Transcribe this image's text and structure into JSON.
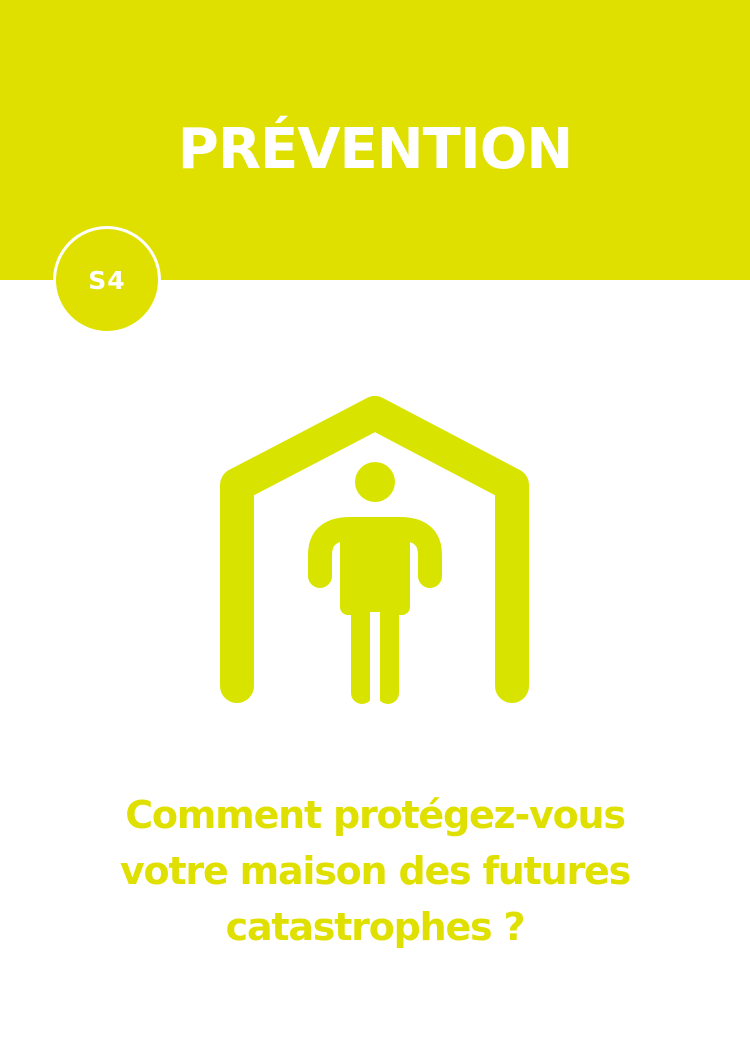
{
  "header": {
    "title": "PRÉVENTION",
    "badge": "S4"
  },
  "icon": {
    "name": "house-person-icon"
  },
  "question": {
    "lines": [
      "Comment protégez-vous",
      "votre maison des futures",
      "catastrophes  ?"
    ]
  },
  "colors": {
    "accent": "#e0e000",
    "text_on_accent": "#ffffff",
    "background": "#ffffff"
  }
}
